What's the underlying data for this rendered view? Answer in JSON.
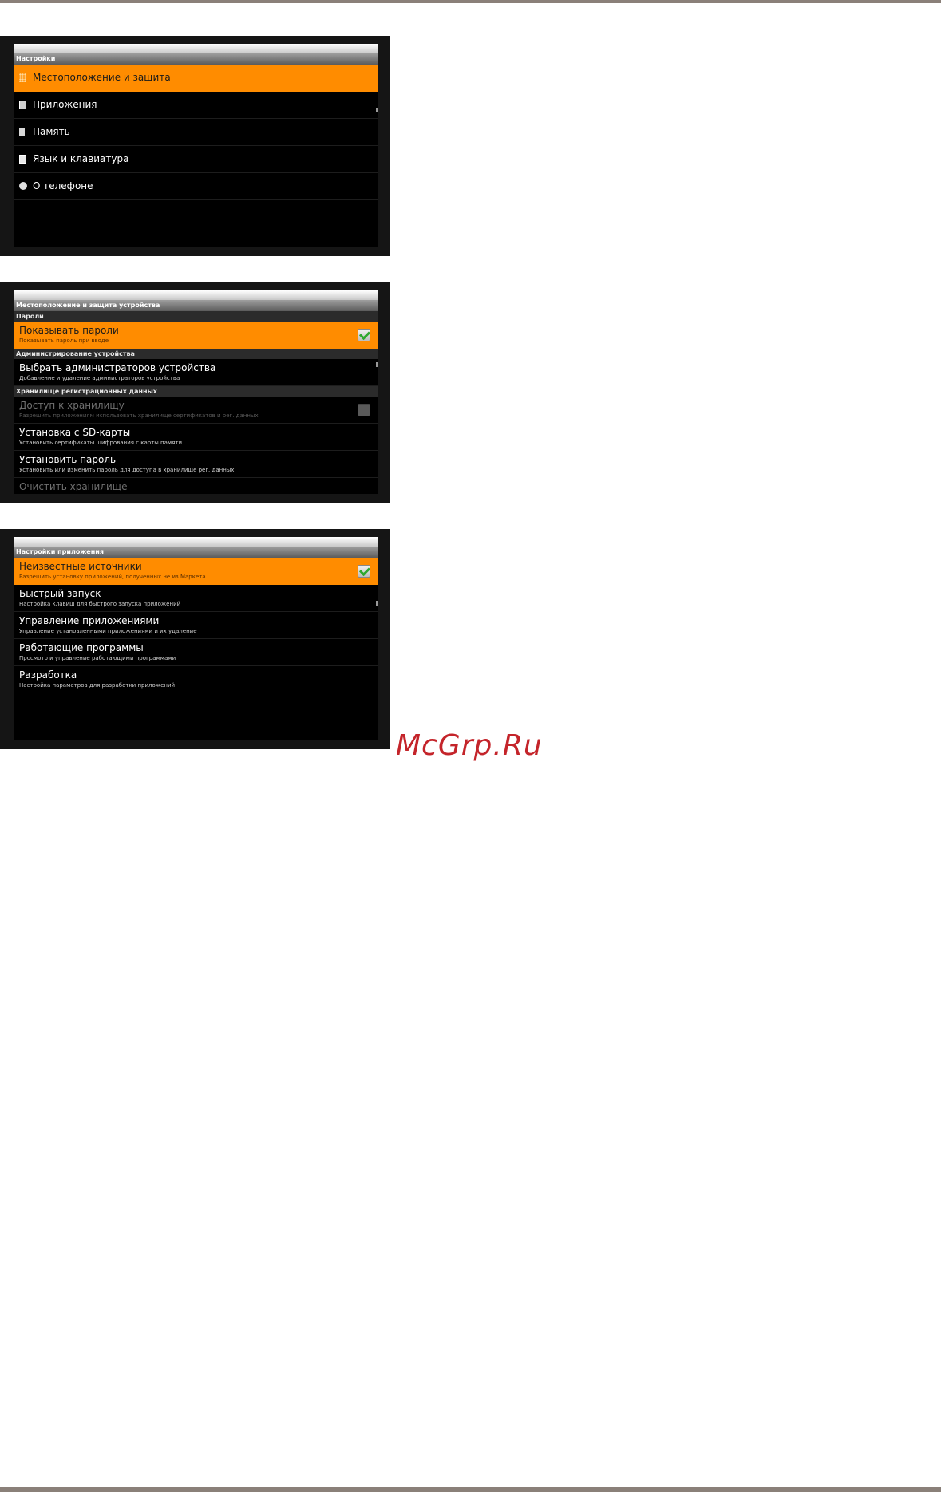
{
  "screen1": {
    "title": "Настройки",
    "items": [
      {
        "label": "Местоположение и защита",
        "icon": "location-grid-icon"
      },
      {
        "label": "Приложения",
        "icon": "applications-icon"
      },
      {
        "label": "Память",
        "icon": "sd-card-icon"
      },
      {
        "label": "Язык и клавиатура",
        "icon": "keyboard-icon"
      },
      {
        "label": "О телефоне",
        "icon": "info-icon"
      }
    ]
  },
  "screen2": {
    "title": "Местоположение и защита устройства",
    "sections": [
      {
        "header": "Пароли"
      },
      {
        "header": "Администрирование устройства"
      },
      {
        "header": "Хранилище регистрационных данных"
      }
    ],
    "items": {
      "show_passwords": {
        "title": "Показывать пароли",
        "subtitle": "Показывать пароль при вводе"
      },
      "device_admins": {
        "title": "Выбрать администраторов устройства",
        "subtitle": "Добавление и удаление администраторов устройства"
      },
      "storage_access": {
        "title": "Доступ к хранилищу",
        "subtitle": "Разрешить приложениям использовать хранилище сертификатов и рег. данных"
      },
      "install_sd": {
        "title": "Установка с SD-карты",
        "subtitle": "Установить сертификаты шифрования с карты памяти"
      },
      "set_password": {
        "title": "Установить пароль",
        "subtitle": "Установить или изменить пароль для доступа в хранилище рег. данных"
      },
      "clear_storage": {
        "title": "Очистить хранилище"
      }
    }
  },
  "screen3": {
    "title": "Настройки приложения",
    "items": [
      {
        "title": "Неизвестные источники",
        "subtitle": "Разрешить установку приложений, полученных не из Маркета"
      },
      {
        "title": "Быстрый запуск",
        "subtitle": "Настройка клавиш для быстрого запуска приложений"
      },
      {
        "title": "Управление приложениями",
        "subtitle": "Управление установленными приложениями и их удаление"
      },
      {
        "title": "Работающие программы",
        "subtitle": "Просмотр и управление работающими программами"
      },
      {
        "title": "Разработка",
        "subtitle": "Настройка параметров для разработки приложений"
      }
    ]
  },
  "watermark": "McGrp.Ru",
  "colors": {
    "highlight": "#ff8c00",
    "watermark": "#c4242a"
  }
}
